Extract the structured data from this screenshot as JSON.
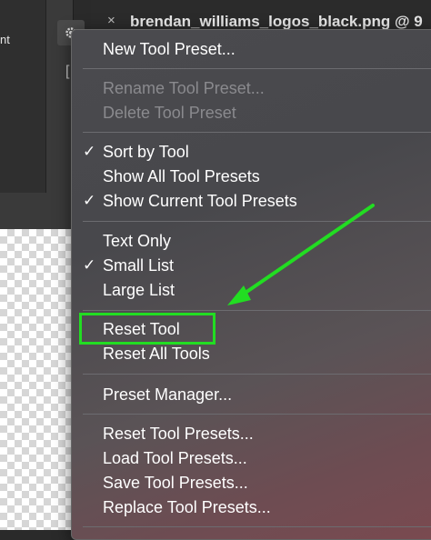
{
  "background": {
    "panel_text": "nt",
    "gear_icon": "gear-icon",
    "bracket_text": "[",
    "tab_close": "×",
    "tab_title": "brendan_williams_logos_black.png @ 9"
  },
  "menu": {
    "items": [
      {
        "label": "New Tool Preset...",
        "checked": false,
        "disabled": false
      },
      {
        "label": "Rename Tool Preset...",
        "checked": false,
        "disabled": true
      },
      {
        "label": "Delete Tool Preset",
        "checked": false,
        "disabled": true
      },
      {
        "label": "Sort by Tool",
        "checked": true,
        "disabled": false
      },
      {
        "label": "Show All Tool Presets",
        "checked": false,
        "disabled": false
      },
      {
        "label": "Show Current Tool Presets",
        "checked": true,
        "disabled": false
      },
      {
        "label": "Text Only",
        "checked": false,
        "disabled": false
      },
      {
        "label": "Small List",
        "checked": true,
        "disabled": false
      },
      {
        "label": "Large List",
        "checked": false,
        "disabled": false
      },
      {
        "label": "Reset Tool",
        "checked": false,
        "disabled": false
      },
      {
        "label": "Reset All Tools",
        "checked": false,
        "disabled": false
      },
      {
        "label": "Preset Manager...",
        "checked": false,
        "disabled": false
      },
      {
        "label": "Reset Tool Presets...",
        "checked": false,
        "disabled": false
      },
      {
        "label": "Load Tool Presets...",
        "checked": false,
        "disabled": false
      },
      {
        "label": "Save Tool Presets...",
        "checked": false,
        "disabled": false
      },
      {
        "label": "Replace Tool Presets...",
        "checked": false,
        "disabled": false
      }
    ],
    "check_glyph": "✓"
  },
  "annotation": {
    "color": "#22dd22",
    "target": "Reset Tool"
  }
}
